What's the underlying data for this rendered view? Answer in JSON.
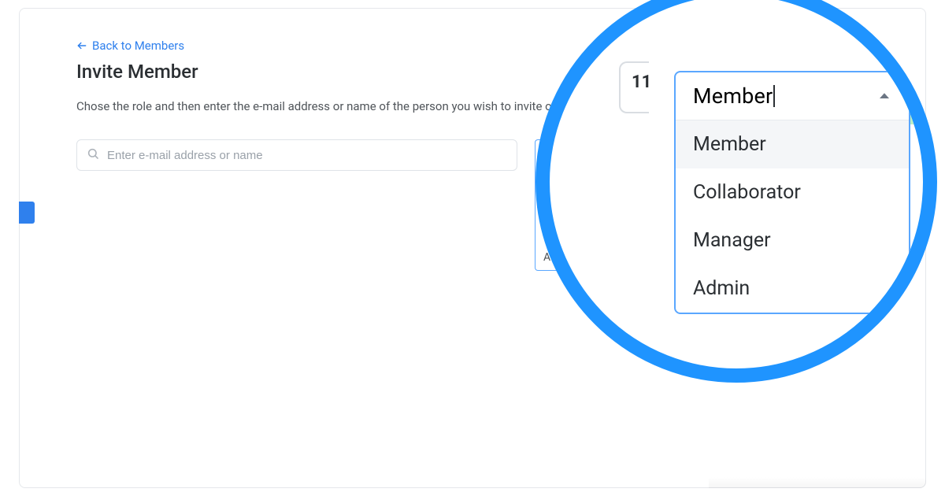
{
  "nav": {
    "back_label": "Back to Members"
  },
  "page": {
    "title": "Invite Member",
    "description": "Chose the role and then enter the e-mail address or name of the person you wish to invite or select one of the existing members."
  },
  "search": {
    "placeholder": "Enter e-mail address or name",
    "value": ""
  },
  "role_select": {
    "value": "Member",
    "options": [
      "Member",
      "Collaborator",
      "Manager",
      "Admin"
    ],
    "highlight_index": 0
  },
  "zoom": {
    "bg_number": "11"
  },
  "colors": {
    "accent_blue": "#2f80ed",
    "ring_blue": "#1f94ff",
    "focus_border": "#5aa7ff"
  }
}
